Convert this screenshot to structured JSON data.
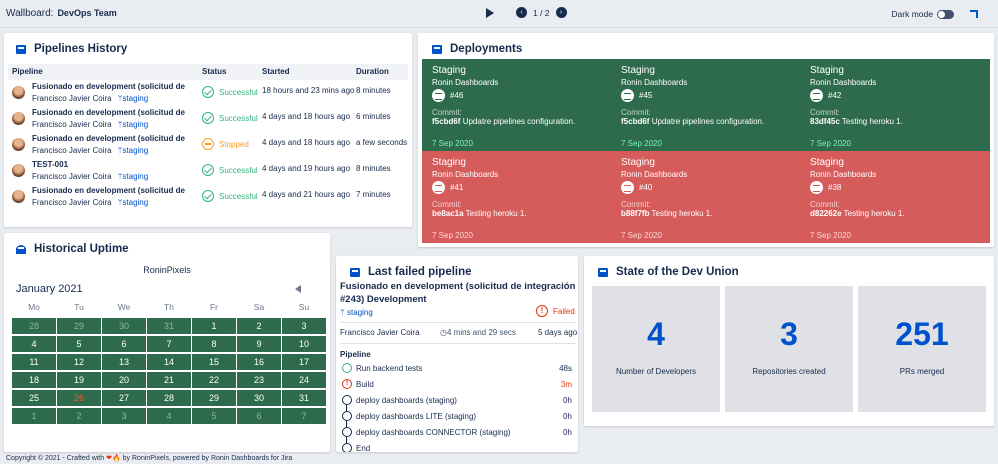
{
  "topbar": {
    "wallboard_label": "Wallboard:",
    "wallboard_name": "DevOps Team",
    "page_indicator": "1 / 2",
    "dark_mode_label": "Dark mode"
  },
  "pipelines": {
    "title": "Pipelines History",
    "headers": [
      "Pipeline",
      "Status",
      "Started",
      "Duration"
    ],
    "rows": [
      {
        "name": "Fusionado en development (solicitud de in...",
        "author": "Francisco Javier Coira",
        "branch": "staging",
        "status": "Successful",
        "started": "18 hours and 23 mins ago",
        "duration": "8 minutes"
      },
      {
        "name": "Fusionado en development (solicitud de in...",
        "author": "Francisco Javier Coira",
        "branch": "staging",
        "status": "Successful",
        "started": "4 days and 18 hours ago",
        "duration": "6 minutes"
      },
      {
        "name": "Fusionado en development (solicitud de in...",
        "author": "Francisco Javier Coira",
        "branch": "staging",
        "status": "Stopped",
        "started": "4 days and 18 hours ago",
        "duration": "a few seconds"
      },
      {
        "name": "TEST-001",
        "author": "Francisco Javier Coira",
        "branch": "staging",
        "status": "Successful",
        "started": "4 days and 19 hours ago",
        "duration": "8 minutes"
      },
      {
        "name": "Fusionado en development (solicitud de in...",
        "author": "Francisco Javier Coira",
        "branch": "staging",
        "status": "Successful",
        "started": "4 days and 21 hours ago",
        "duration": "7 minutes"
      }
    ]
  },
  "deployments": {
    "title": "Deployments",
    "commit_label": "Commit:",
    "items": [
      {
        "env": "Staging",
        "project": "Ronin Dashboards",
        "build": "#46",
        "hash": "f5cbd6f",
        "message": "Updatre pipelines configuration.",
        "date": "7 Sep 2020",
        "state": "success"
      },
      {
        "env": "Staging",
        "project": "Ronin Dashboards",
        "build": "#45",
        "hash": "f5cbd6f",
        "message": "Updatre pipelines configuration.",
        "date": "7 Sep 2020",
        "state": "success"
      },
      {
        "env": "Staging",
        "project": "Ronin Dashboards",
        "build": "#42",
        "hash": "83df45c",
        "message": "Testing heroku 1.",
        "date": "7 Sep 2020",
        "state": "success"
      },
      {
        "env": "Staging",
        "project": "Ronin Dashboards",
        "build": "#41",
        "hash": "be8ac1a",
        "message": "Testing heroku 1.",
        "date": "7 Sep 2020",
        "state": "failed"
      },
      {
        "env": "Staging",
        "project": "Ronin Dashboards",
        "build": "#40",
        "hash": "b88f7fb",
        "message": "Testing heroku 1.",
        "date": "7 Sep 2020",
        "state": "failed"
      },
      {
        "env": "Staging",
        "project": "Ronin Dashboards",
        "build": "#38",
        "hash": "d82262e",
        "message": "Testing heroku 1.",
        "date": "7 Sep 2020",
        "state": "failed"
      }
    ]
  },
  "uptime": {
    "title": "Historical Uptime",
    "project": "RoninPixels",
    "month": "January 2021",
    "weekdays": [
      "Mo",
      "Tu",
      "We",
      "Th",
      "Fr",
      "Sa",
      "Su"
    ],
    "days": [
      [
        "28",
        "29",
        "30",
        "31",
        "1",
        "2",
        "3"
      ],
      [
        "4",
        "5",
        "6",
        "7",
        "8",
        "9",
        "10"
      ],
      [
        "11",
        "12",
        "13",
        "14",
        "15",
        "16",
        "17"
      ],
      [
        "18",
        "19",
        "20",
        "21",
        "22",
        "23",
        "24"
      ],
      [
        "25",
        "26",
        "27",
        "28",
        "29",
        "30",
        "31"
      ],
      [
        "1",
        "2",
        "3",
        "4",
        "5",
        "6",
        "7"
      ]
    ],
    "today": "26"
  },
  "last_failed": {
    "title": "Last failed pipeline",
    "pipeline_name": "Fusionado en development (solicitud de integración #243) Development",
    "branch": "staging",
    "status": "Failed",
    "author": "Francisco Javier Coira",
    "duration": "4 mins and 29 secs",
    "ago": "5 days ago",
    "steps_label": "Pipeline",
    "steps": [
      {
        "name": "Run backend tests",
        "time": "48s",
        "state": "ok"
      },
      {
        "name": "Build",
        "time": "3m",
        "state": "fail"
      },
      {
        "name": "deploy dashboards (staging)",
        "time": "0h",
        "state": "pending"
      },
      {
        "name": "deploy dashboards LITE (staging)",
        "time": "0h",
        "state": "pending"
      },
      {
        "name": "deploy dashboards CONNECTOR (staging)",
        "time": "0h",
        "state": "pending"
      },
      {
        "name": "End",
        "time": "",
        "state": "pending"
      }
    ]
  },
  "union": {
    "title": "State of the Dev Union",
    "stats": [
      {
        "value": "4",
        "label": "Number of Developers"
      },
      {
        "value": "3",
        "label": "Repositories created"
      },
      {
        "value": "251",
        "label": "PRs merged"
      }
    ]
  },
  "footer": {
    "text_before": "Copyright © 2021 - Crafted with",
    "text_after": "by RoninPixels, powered by Ronin Dashboards for Jira"
  },
  "colors": {
    "success_green": "#2e6b4d",
    "failed_red": "#d65c5c",
    "brand_blue": "#0052cc"
  }
}
